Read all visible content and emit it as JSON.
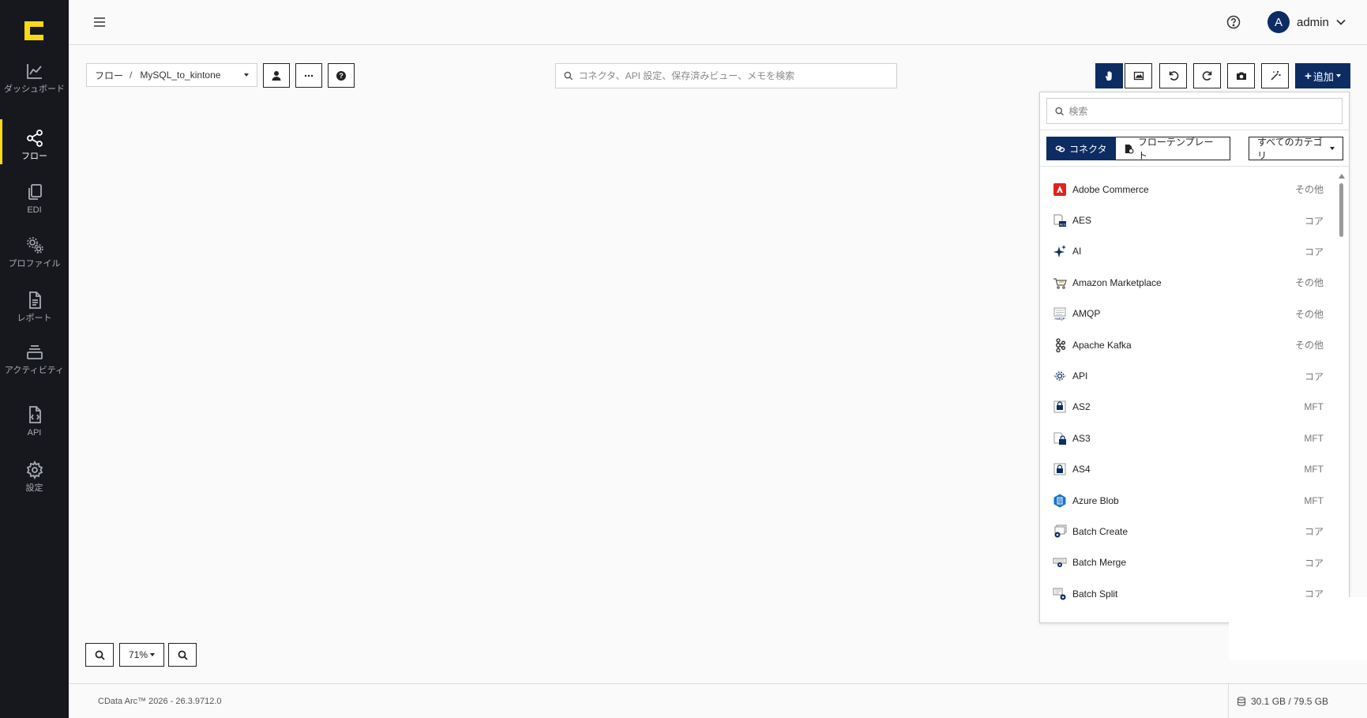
{
  "sidebar": {
    "items": [
      {
        "label": "ダッシュボード",
        "icon": "dashboard-chart-icon"
      },
      {
        "label": "フロー",
        "icon": "flow-share-icon"
      },
      {
        "label": "EDI",
        "icon": "edi-documents-icon"
      },
      {
        "label": "プロファイル",
        "icon": "profile-gears-icon"
      },
      {
        "label": "レポート",
        "icon": "report-file-icon"
      },
      {
        "label": "アクティビティ",
        "icon": "activity-stack-icon"
      },
      {
        "label": "API",
        "icon": "api-code-file-icon"
      },
      {
        "label": "設定",
        "icon": "settings-gear-icon"
      }
    ],
    "active": "フロー",
    "accent": "#f8d914"
  },
  "header": {
    "user_initial": "A",
    "username": "admin"
  },
  "toolbar": {
    "breadcrumb_root": "フロー",
    "breadcrumb_sep": "/",
    "flow_name": "MySQL_to_kintone",
    "search_placeholder": "コネクタ、API 設定、保存済みビュー、メモを検索",
    "add_label": "追加"
  },
  "panel": {
    "search_placeholder": "検索",
    "tab_connector": "コネクタ",
    "tab_template": "フローテンプレート",
    "category_select": "すべてのカテゴリ",
    "connectors": [
      {
        "name": "Adobe Commerce",
        "category": "その他",
        "icon": "adobe-commerce-icon"
      },
      {
        "name": "AES",
        "category": "コア",
        "icon": "aes-lock-icon"
      },
      {
        "name": "AI",
        "category": "コア",
        "icon": "ai-sparkle-icon"
      },
      {
        "name": "Amazon Marketplace",
        "category": "その他",
        "icon": "amazon-cart-icon"
      },
      {
        "name": "AMQP",
        "category": "その他",
        "icon": "amqp-icon"
      },
      {
        "name": "Apache Kafka",
        "category": "その他",
        "icon": "kafka-icon"
      },
      {
        "name": "API",
        "category": "コア",
        "icon": "api-gear-icon"
      },
      {
        "name": "AS2",
        "category": "MFT",
        "icon": "as2-icon"
      },
      {
        "name": "AS3",
        "category": "MFT",
        "icon": "as3-icon"
      },
      {
        "name": "AS4",
        "category": "MFT",
        "icon": "as4-icon"
      },
      {
        "name": "Azure Blob",
        "category": "MFT",
        "icon": "azure-blob-icon"
      },
      {
        "name": "Batch Create",
        "category": "コア",
        "icon": "batch-create-icon"
      },
      {
        "name": "Batch Merge",
        "category": "コア",
        "icon": "batch-merge-icon"
      },
      {
        "name": "Batch Split",
        "category": "コア",
        "icon": "batch-split-icon"
      }
    ]
  },
  "zoom": {
    "level": "71%"
  },
  "footer": {
    "version": "CData Arc™ 2026 - 26.3.9712.0",
    "storage": "30.1 GB / 79.5 GB"
  },
  "colors": {
    "brand_dark": "#0c2c63",
    "sidebar_bg": "#16181d"
  }
}
